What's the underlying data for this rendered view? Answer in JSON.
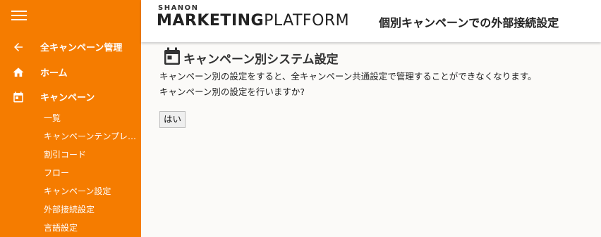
{
  "sidebar": {
    "back_item": "全キャンペーン管理",
    "home_item": "ホーム",
    "campaign_item": "キャンペーン",
    "sub_items": [
      "一覧",
      "キャンペーンテンプレート",
      "割引コード",
      "フロー",
      "キャンペーン設定",
      "外部接続設定",
      "言語設定"
    ]
  },
  "header": {
    "logo_top": "SHANON",
    "logo_marketing": "MARKETING",
    "logo_platform": "PLATFORM",
    "page_title": "個別キャンペーンでの外部接続設定"
  },
  "main": {
    "section_title": "キャンペーン別システム設定",
    "message_line1": "キャンペーン別の設定をすると、全キャンペーン共通設定で管理することができなくなります。",
    "message_line2": "キャンペーン別の設定を行いますか?",
    "yes_button": "はい"
  },
  "colors": {
    "sidebar": "#f57c00",
    "header": "#ffffff",
    "background": "#fbfaf8"
  }
}
